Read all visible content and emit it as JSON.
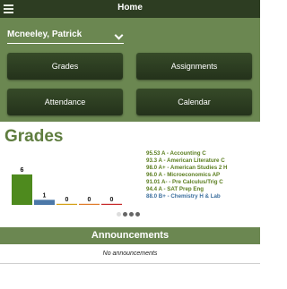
{
  "header": {
    "title": "Home",
    "menu_icon": "hamburger-menu-icon"
  },
  "student": {
    "selected": "Mcneeley, Patrick",
    "dropdown_icon": "chevron-down-icon"
  },
  "nav_buttons": {
    "grades": "Grades",
    "assignments": "Assignments",
    "attendance": "Attendance",
    "calendar": "Calendar"
  },
  "grades_section": {
    "title": "Grades",
    "courses": [
      "95.53 A - Accounting C",
      "93.3 A - American Literature C",
      "98.0 A+ - American Studies 2 H",
      "96.0 A - Microeconomics AP",
      "91.01 A- - Pre Calculus/Trig C",
      "94.4 A - SAT Prep Eng",
      "88.0 B+ - Chemistry H & Lab"
    ],
    "pager": {
      "pages": 4,
      "active_index": 0
    }
  },
  "chart_data": {
    "type": "bar",
    "categories": [
      "A",
      "B",
      "C",
      "D",
      "F"
    ],
    "values": [
      6,
      1,
      0,
      0,
      0
    ],
    "colors": [
      "#4e8a1e",
      "#4c78a8",
      "#d4a017",
      "#e07b2a",
      "#c62828"
    ],
    "ylim": [
      0,
      6
    ]
  },
  "announcements": {
    "title": "Announcements",
    "empty_text": "No announcements"
  },
  "colors": {
    "topbar": "#2d3d22",
    "panel": "#6b8751",
    "button": "#2c3d22",
    "heading": "#5f7d3f",
    "grade_a": "#5a7d1e",
    "grade_b": "#3c6f9e"
  }
}
